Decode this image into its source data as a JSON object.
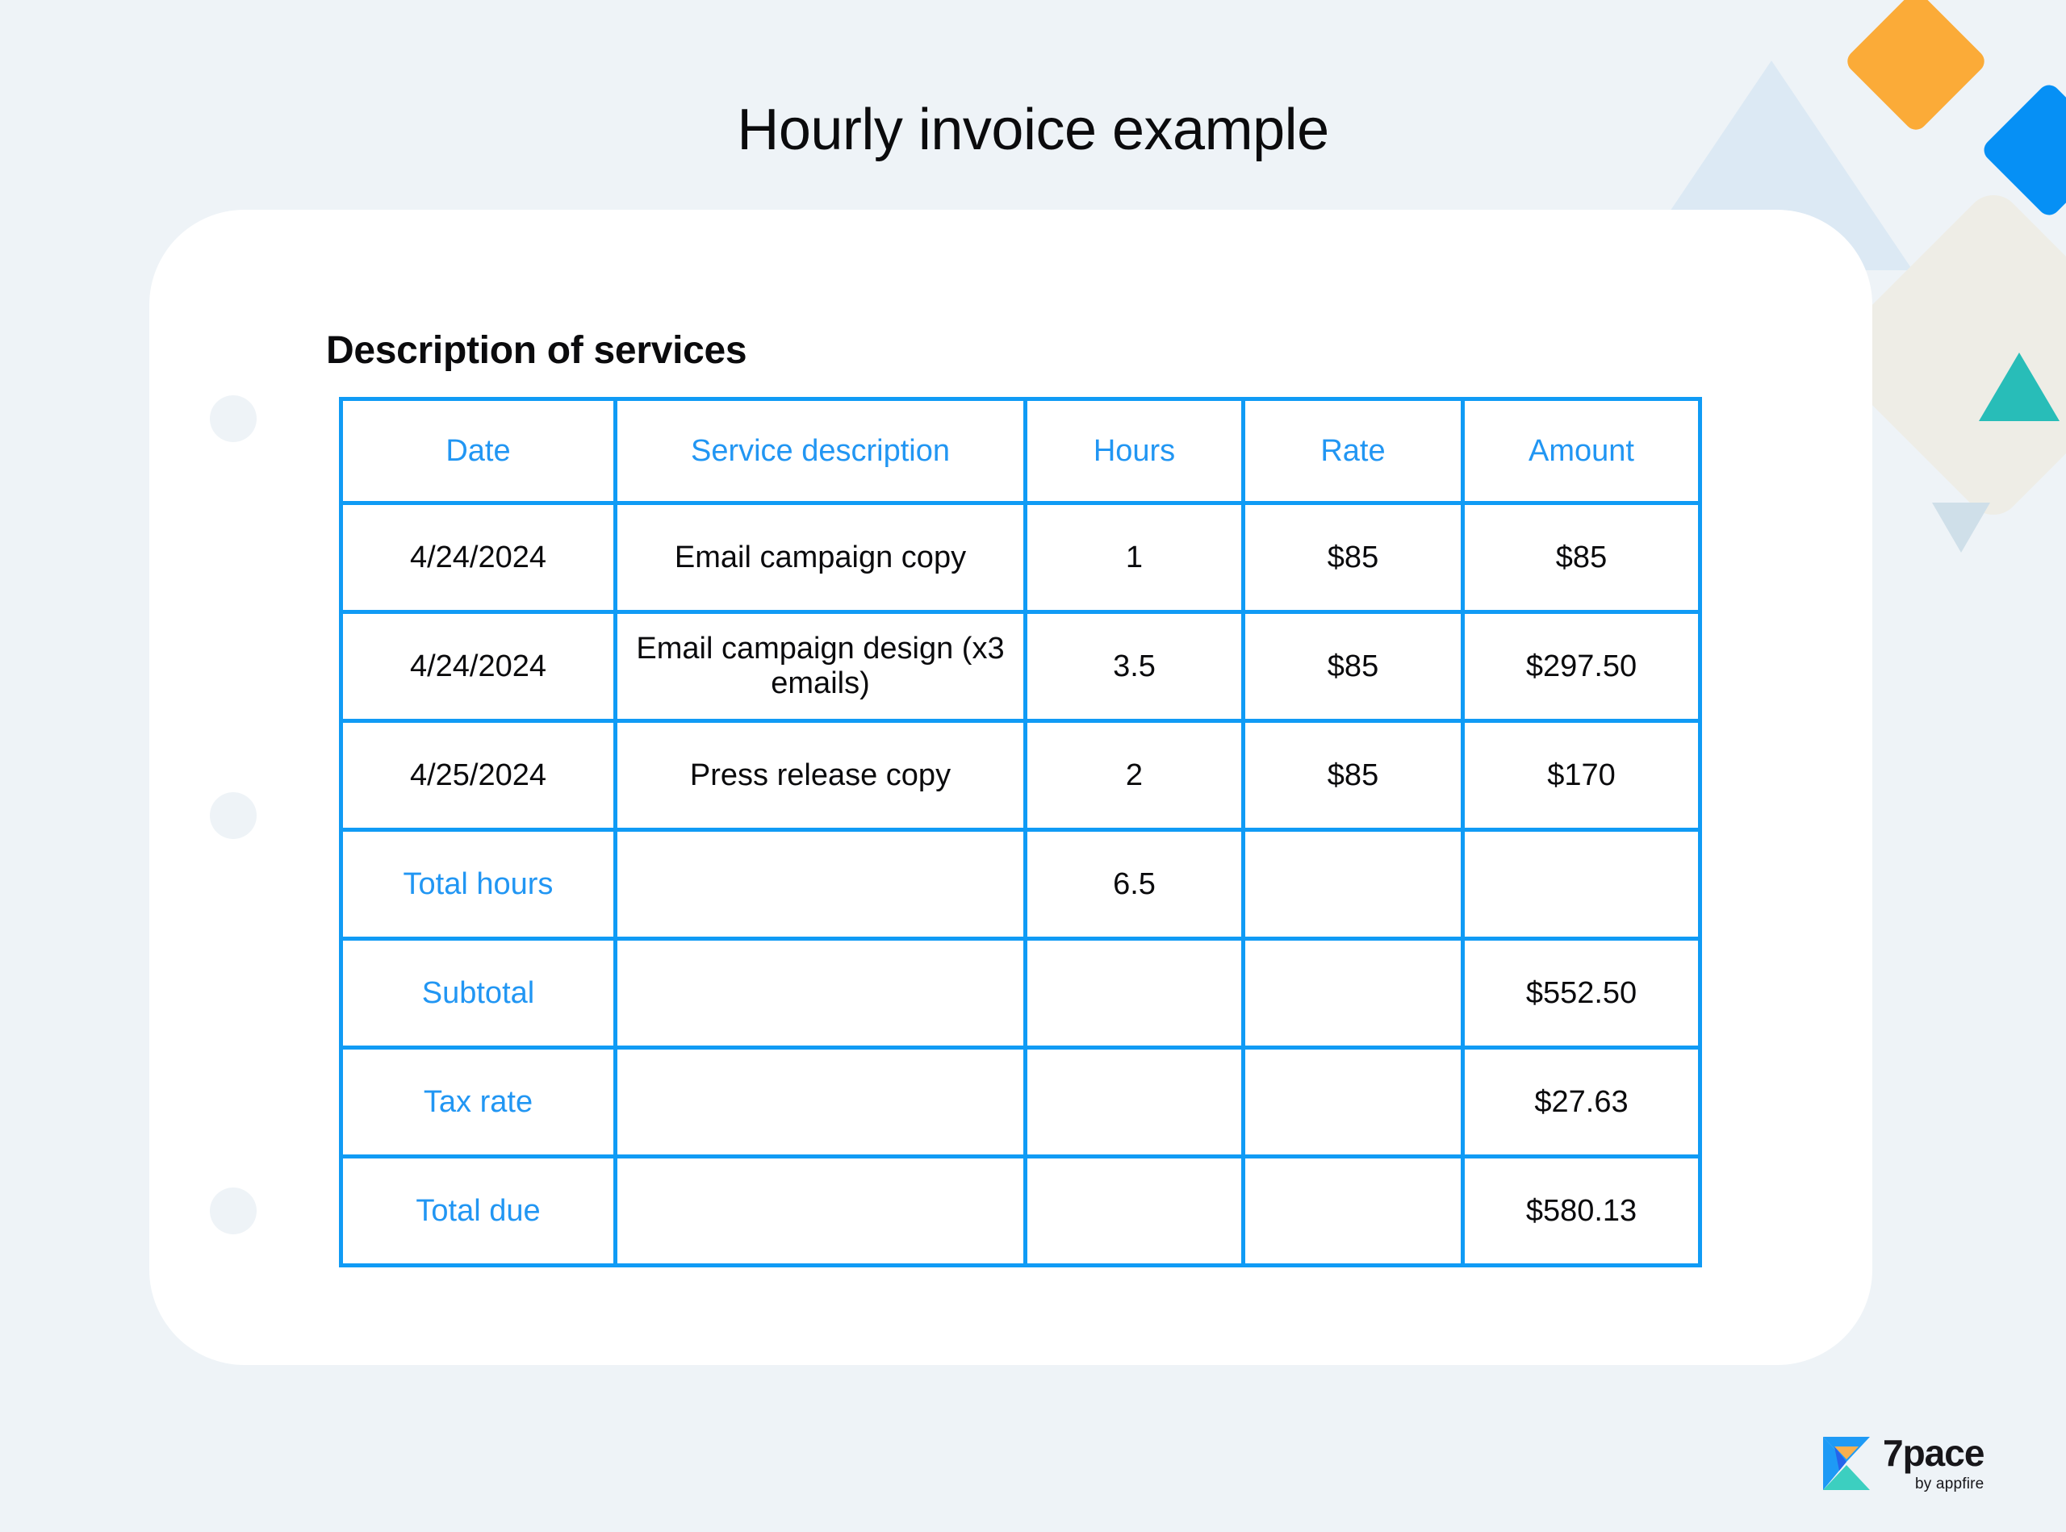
{
  "page": {
    "title": "Hourly invoice example",
    "background_color": "#eef3f7",
    "card_color": "#ffffff"
  },
  "section": {
    "heading": "Description of services"
  },
  "table": {
    "border_color": "#109bf5",
    "label_color": "#2196f3",
    "columns": [
      "Date",
      "Service description",
      "Hours",
      "Rate",
      "Amount"
    ],
    "rows": [
      {
        "date": "4/24/2024",
        "description": "Email campaign copy",
        "hours": "1",
        "rate": "$85",
        "amount": "$85"
      },
      {
        "date": "4/24/2024",
        "description": "Email campaign design (x3 emails)",
        "hours": "3.5",
        "rate": "$85",
        "amount": "$297.50"
      },
      {
        "date": "4/25/2024",
        "description": "Press release copy",
        "hours": "2",
        "rate": "$85",
        "amount": "$170"
      }
    ],
    "summary": [
      {
        "label": "Total hours",
        "description": "",
        "hours": "6.5",
        "rate": "",
        "amount": ""
      },
      {
        "label": "Subtotal",
        "description": "",
        "hours": "",
        "rate": "",
        "amount": "$552.50"
      },
      {
        "label": "Tax rate",
        "description": "",
        "hours": "",
        "rate": "",
        "amount": "$27.63"
      },
      {
        "label": "Total due",
        "description": "",
        "hours": "",
        "rate": "",
        "amount": "$580.13"
      }
    ]
  },
  "logo": {
    "name": "7pace",
    "subtitle": "by appfire",
    "mark_icon": "hourglass-logo-icon",
    "colors": {
      "blue": "#1e9af5",
      "teal": "#3ccfc0",
      "orange": "#f9b04e",
      "deep_blue": "#2564eb"
    }
  },
  "decorations": {
    "triangle_light_blue_up": "#dce9f4",
    "diamond_orange": "#fbab38",
    "diamond_blue": "#0690f5",
    "diamond_cream": "#eeede6",
    "triangle_teal_up": "#28bdb8",
    "triangle_light_blue_down": "#cfdfe9",
    "hole_punch": "#eef3f7"
  }
}
